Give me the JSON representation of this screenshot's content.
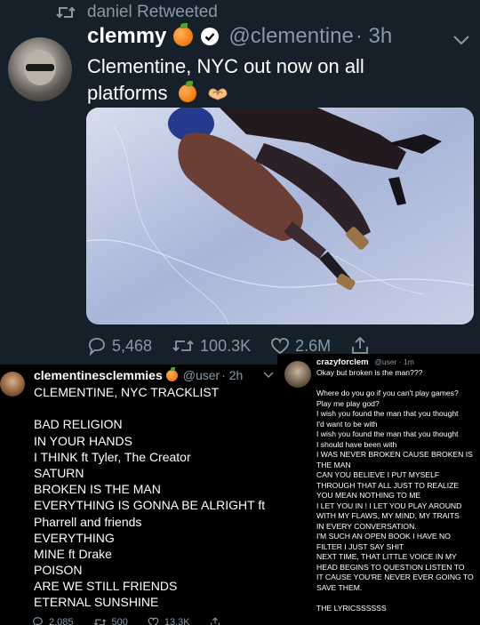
{
  "main_tweet": {
    "retweeted_by": "daniel Retweeted",
    "display_name": "clemmy",
    "handle": "@clementine",
    "time": "· 3h",
    "text_line1": "Clementine, NYC out now on all",
    "text_line2": "platforms",
    "replies": "5,468",
    "retweets": "100.3K",
    "likes": "2.6M"
  },
  "left_tweet": {
    "display_name": "clementinesclemmies",
    "handle": "@user",
    "time": "· 2h",
    "lines": [
      "CLEMENTINE, NYC TRACKLIST",
      "",
      "BAD RELIGION",
      "IN YOUR HANDS",
      "I THINK ft Tyler, The Creator",
      "SATURN",
      "BROKEN IS THE MAN",
      "EVERYTHING IS GONNA BE ALRIGHT ft",
      "Pharrell and friends",
      "EVERYTHING",
      "MINE ft Drake",
      "POISON",
      "ARE WE STILL FRIENDS",
      "ETERNAL SUNSHINE"
    ],
    "replies": "2,085",
    "retweets": "500",
    "likes": "13.3K"
  },
  "right_tweet": {
    "display_name": "crazyforclem",
    "handle": "@user · 1m",
    "lines": [
      "Okay but broken is the man???",
      "",
      "Where do you go if you can't play games?",
      "Play me play god?",
      "I wish you found the man that you thought",
      "I'd want to be with",
      "I wish you found the man that you thought",
      "I should have been with",
      "I WAS NEVER BROKEN CAUSE BROKEN IS",
      "THE MAN",
      "CAN YOU BELIEVE I PUT MYSELF",
      "THROUGH THAT ALL JUST TO REALIZE",
      "YOU MEAN NOTHING TO ME",
      "I LET YOU IN ! I LET YOU PLAY AROUND",
      "WITH MY FLAWS, MY MIND, MY TRAITS",
      "IN EVERY CONVERSATION.",
      "I'M SUCH AN OPEN BOOK I HAVE NO",
      "FILTER I JUST SAY SHIT",
      "NEXT TIME, THAT LITTLE VOICE IN MY",
      "HEAD BEGINS TO QUESTION LISTEN TO",
      "IT CAUSE YOU'RE NEVER EVER GOING TO",
      "SAVE THEM.",
      "",
      "THE LYRICSSSSSS"
    ]
  },
  "colors": {
    "bg_dark": "#15202b",
    "muted": "#8899a6",
    "peach": "#f07a10"
  }
}
